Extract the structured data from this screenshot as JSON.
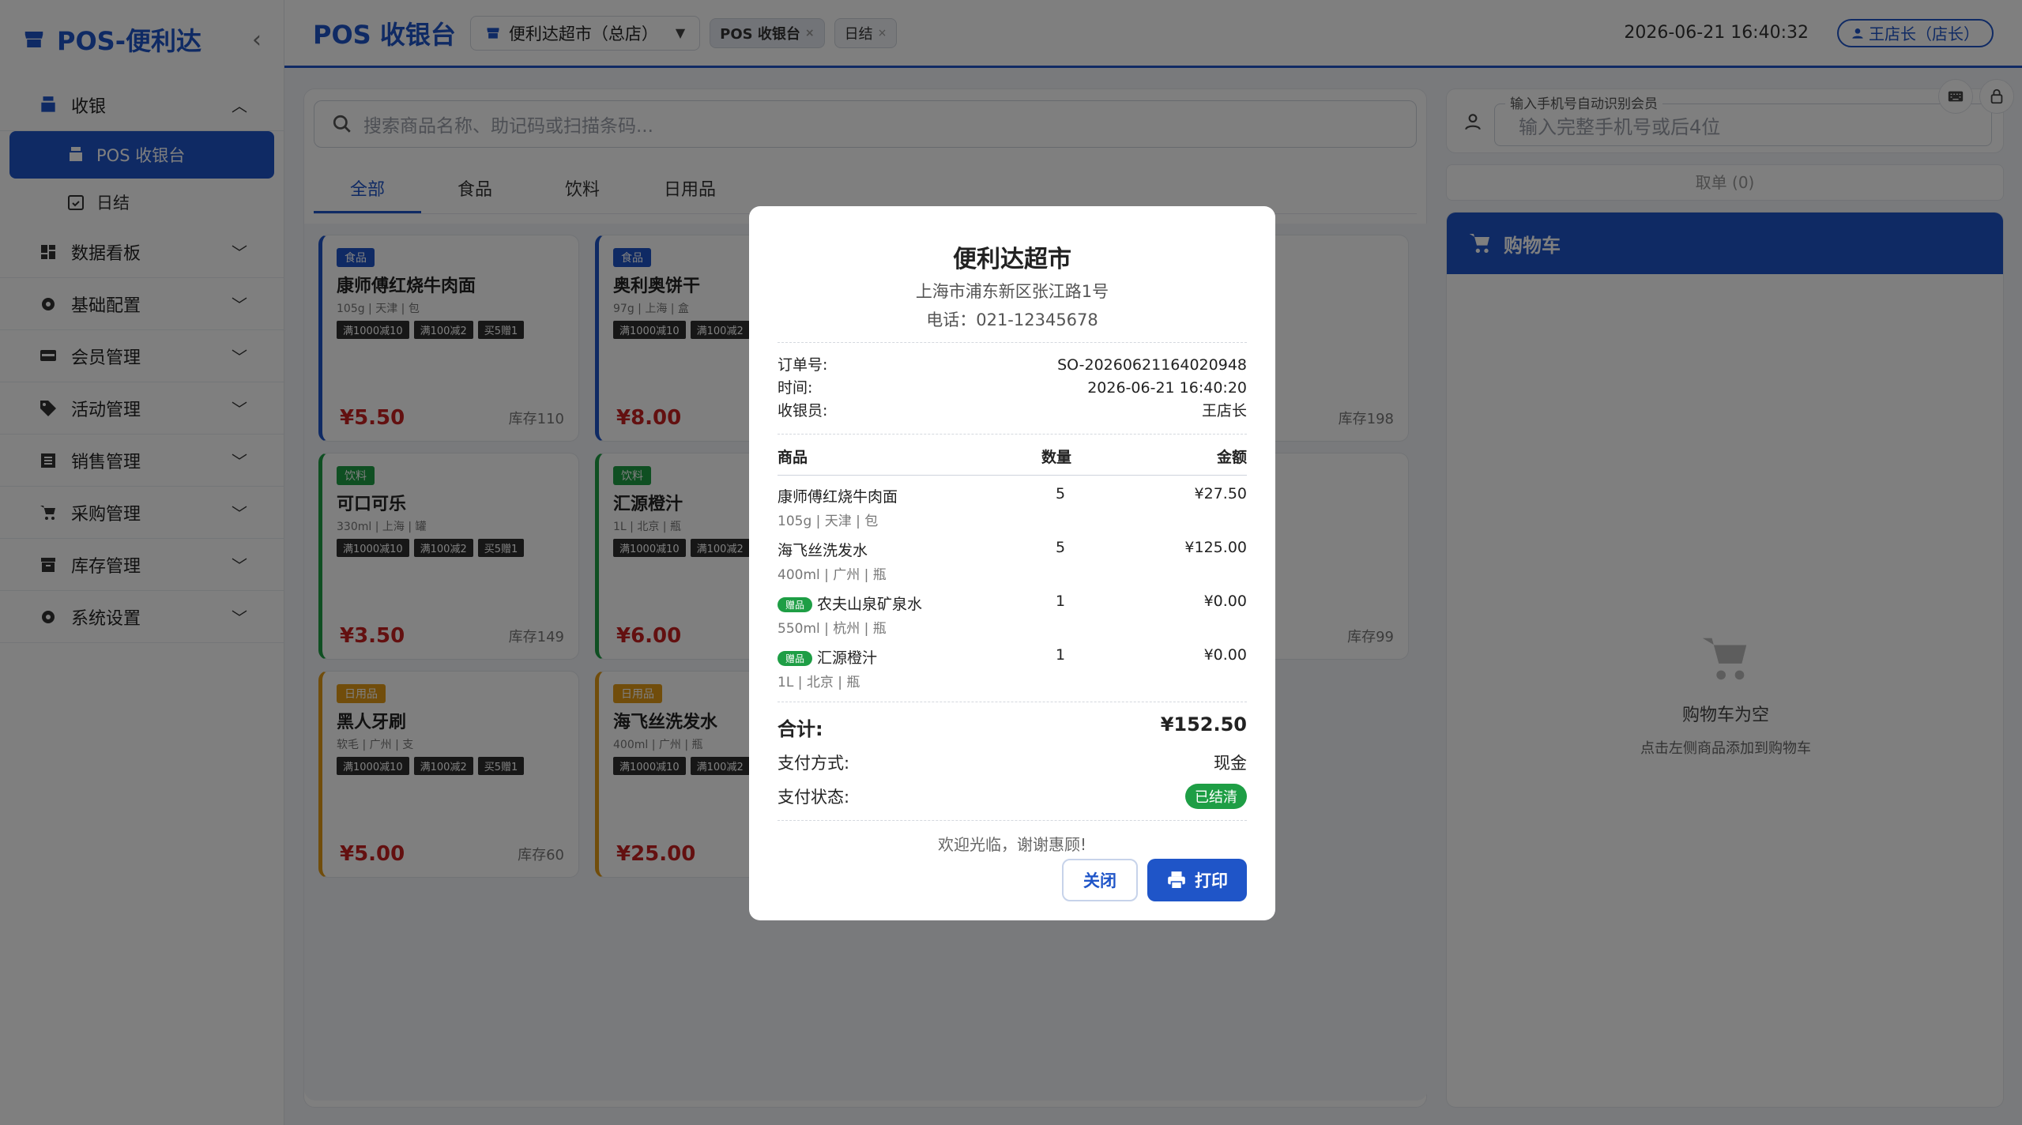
{
  "app": {
    "brand": "POS-便利达"
  },
  "sidebar": {
    "items": [
      {
        "label": "收银",
        "icon": "register-icon"
      },
      {
        "label": "数据看板",
        "icon": "dashboard-icon"
      },
      {
        "label": "基础配置",
        "icon": "gear-icon"
      },
      {
        "label": "会员管理",
        "icon": "member-card-icon"
      },
      {
        "label": "活动管理",
        "icon": "tag-icon"
      },
      {
        "label": "销售管理",
        "icon": "list-icon"
      },
      {
        "label": "采购管理",
        "icon": "cart-icon"
      },
      {
        "label": "库存管理",
        "icon": "inventory-icon"
      },
      {
        "label": "系统设置",
        "icon": "gear-icon"
      }
    ],
    "sub_items": [
      {
        "label": "POS 收银台",
        "active": true
      },
      {
        "label": "日结",
        "active": false
      }
    ]
  },
  "header": {
    "title": "POS 收银台",
    "store": "便利达超市（总店）",
    "tabs": [
      "POS 收银台",
      "日结"
    ],
    "datetime": "2026-06-21 16:40:32",
    "user": "王店长（店长）"
  },
  "main": {
    "search_placeholder": "搜索商品名称、助记码或扫描条码...",
    "category_tabs": [
      "全部",
      "食品",
      "饮料",
      "日用品"
    ]
  },
  "products": [
    {
      "category": "食品",
      "name": "康师傅红烧牛肉面",
      "spec": "105g | 天津 | 包",
      "price": "¥5.50",
      "stock": "库存110",
      "type": "food"
    },
    {
      "category": "食品",
      "name": "奥利奥饼干",
      "spec": "97g | 上海 | 盒",
      "price": "¥8.00",
      "stock": "库存198",
      "type": "food"
    },
    {
      "category": "饮料",
      "name": "可口可乐",
      "spec": "330ml | 上海 | 罐",
      "price": "¥3.50",
      "stock": "库存149",
      "type": "drink"
    },
    {
      "category": "饮料",
      "name": "汇源橙汁",
      "spec": "1L | 北京 | 瓶",
      "price": "¥6.00",
      "stock": "库存99",
      "type": "drink"
    },
    {
      "category": "日用品",
      "name": "黑人牙刷",
      "spec": "软毛 | 广州 | 支",
      "price": "¥5.00",
      "stock": "库存60",
      "type": "daily"
    },
    {
      "category": "日用品",
      "name": "海飞丝洗发水",
      "spec": "400ml | 广州 | 瓶",
      "price": "¥25.00",
      "stock": "",
      "type": "daily"
    }
  ],
  "promos": [
    "满1000减10",
    "满100减2",
    "买5赠1"
  ],
  "member": {
    "label": "输入手机号自动识别会员",
    "placeholder": "输入完整手机号或后4位"
  },
  "pending_orders": "取单 (0)",
  "cart": {
    "title": "购物车",
    "empty_title": "购物车为空",
    "empty_hint": "点击左侧商品添加到购物车"
  },
  "receipt": {
    "store_name": "便利达超市",
    "address": "上海市浦东新区张江路1号",
    "phone": "电话：021-12345678",
    "order_label": "订单号:",
    "order_no": "SO-20260621164020948",
    "time_label": "时间:",
    "time": "2026-06-21 16:40:20",
    "cashier_label": "收银员:",
    "cashier": "王店长",
    "col_name": "商品",
    "col_qty": "数量",
    "col_amount": "金额",
    "items": [
      {
        "name": "康师傅红烧牛肉面",
        "spec": "105g | 天津 | 包",
        "qty": "5",
        "amount": "¥27.50",
        "gift": ""
      },
      {
        "name": "海飞丝洗发水",
        "spec": "400ml | 广州 | 瓶",
        "qty": "5",
        "amount": "¥125.00",
        "gift": ""
      },
      {
        "name": "农夫山泉矿泉水",
        "spec": "550ml | 杭州 | 瓶",
        "qty": "1",
        "amount": "¥0.00",
        "gift": "赠品"
      },
      {
        "name": "汇源橙汁",
        "spec": "1L | 北京 | 瓶",
        "qty": "1",
        "amount": "¥0.00",
        "gift": "赠品"
      }
    ],
    "total_label": "合计:",
    "total": "¥152.50",
    "pay_method_label": "支付方式:",
    "pay_method": "现金",
    "pay_status_label": "支付状态:",
    "pay_status": "已结清",
    "thanks": "欢迎光临，谢谢惠顾!",
    "close_label": "关闭",
    "print_label": "打印"
  },
  "colors": {
    "primary": "#1f55c8",
    "price": "#c62020",
    "food": "#1f55c8",
    "drink": "#1e9e45",
    "daily": "#e39b16"
  }
}
